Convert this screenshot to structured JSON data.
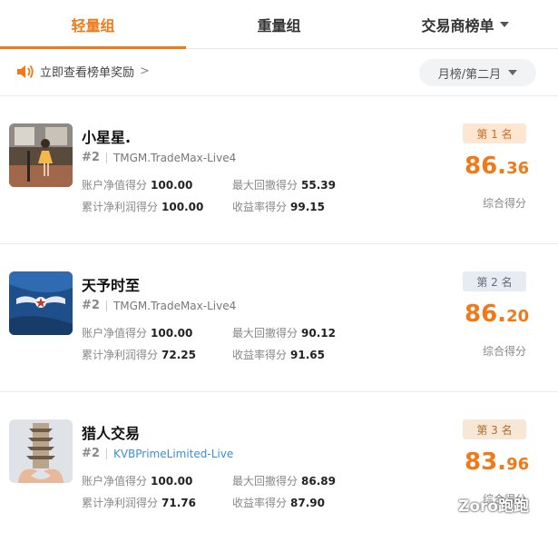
{
  "tabs": [
    {
      "label": "轻量组",
      "active": true
    },
    {
      "label": "重量组",
      "active": false
    },
    {
      "label": "交易商榜单",
      "active": false
    }
  ],
  "notice": {
    "text": "立即查看榜单奖励",
    "chevron": ">"
  },
  "period": {
    "label": "月榜/第二月"
  },
  "icons": {
    "speaker": "speaker-icon",
    "caret": "caret-down-icon"
  },
  "colors": {
    "accent": "#f07a1a",
    "link": "#3a8fd6"
  },
  "stat_labels": {
    "net_value": "账户净值得分",
    "drawdown": "最大回撤得分",
    "profit": "累计净利润得分",
    "yield": "收益率得分"
  },
  "score_label": "综合得分",
  "entries": [
    {
      "name": "小星星.",
      "group_num": "#2",
      "account": "TMGM.TradeMax-Live4",
      "account_is_link": false,
      "net_value": "100.00",
      "drawdown": "55.39",
      "profit": "100.00",
      "yield": "99.15",
      "rank": "第 1 名",
      "score_int": "86.",
      "score_dec": "36"
    },
    {
      "name": "天予时至",
      "group_num": "#2",
      "account": "TMGM.TradeMax-Live4",
      "account_is_link": false,
      "net_value": "100.00",
      "drawdown": "90.12",
      "profit": "72.25",
      "yield": "91.65",
      "rank": "第 2 名",
      "score_int": "86.",
      "score_dec": "20"
    },
    {
      "name": "猎人交易",
      "group_num": "#2",
      "account": "KVBPrimeLimited-Live",
      "account_is_link": true,
      "net_value": "100.00",
      "drawdown": "86.89",
      "profit": "71.76",
      "yield": "87.90",
      "rank": "第 3 名",
      "score_int": "83.",
      "score_dec": "96"
    }
  ],
  "watermark": "Zoro跑跑"
}
